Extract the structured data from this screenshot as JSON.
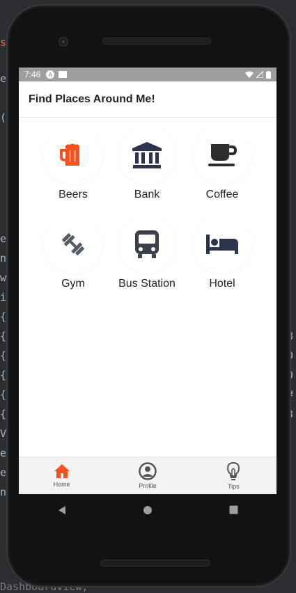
{
  "background": {
    "code_fragments": [
      "s",
      "e",
      "(",
      "e",
      "n",
      "w",
      "i",
      "{",
      "{",
      "{",
      "{",
      "{",
      "{",
      "V",
      "e",
      "e",
      "n",
      "8",
      "0",
      "0",
      "#",
      "3",
      "DashboardView;"
    ]
  },
  "status_bar": {
    "time": "7:46",
    "badge": "A"
  },
  "app_bar": {
    "title": "Find Places Around Me!"
  },
  "categories": [
    {
      "label": "Beers",
      "icon": "beer-mug-icon",
      "color": "#f4511e"
    },
    {
      "label": "Bank",
      "icon": "bank-icon",
      "color": "#2d3450"
    },
    {
      "label": "Coffee",
      "icon": "coffee-cup-icon",
      "color": "#2d2d2d"
    },
    {
      "label": "Gym",
      "icon": "dumbbell-icon",
      "color": "#555a63"
    },
    {
      "label": "Bus Station",
      "icon": "bus-icon",
      "color": "#3a3f4a"
    },
    {
      "label": "Hotel",
      "icon": "bed-icon",
      "color": "#2d3450"
    }
  ],
  "bottom_nav": {
    "items": [
      {
        "label": "Home",
        "icon": "home-icon",
        "color": "#f4511e",
        "active": true
      },
      {
        "label": "Profile",
        "icon": "profile-icon",
        "color": "#555555",
        "active": false
      },
      {
        "label": "Tips",
        "icon": "lightbulb-icon",
        "color": "#555555",
        "active": false
      }
    ]
  },
  "colors": {
    "accent": "#f4511e",
    "status_bar": "#9e9e9e"
  }
}
